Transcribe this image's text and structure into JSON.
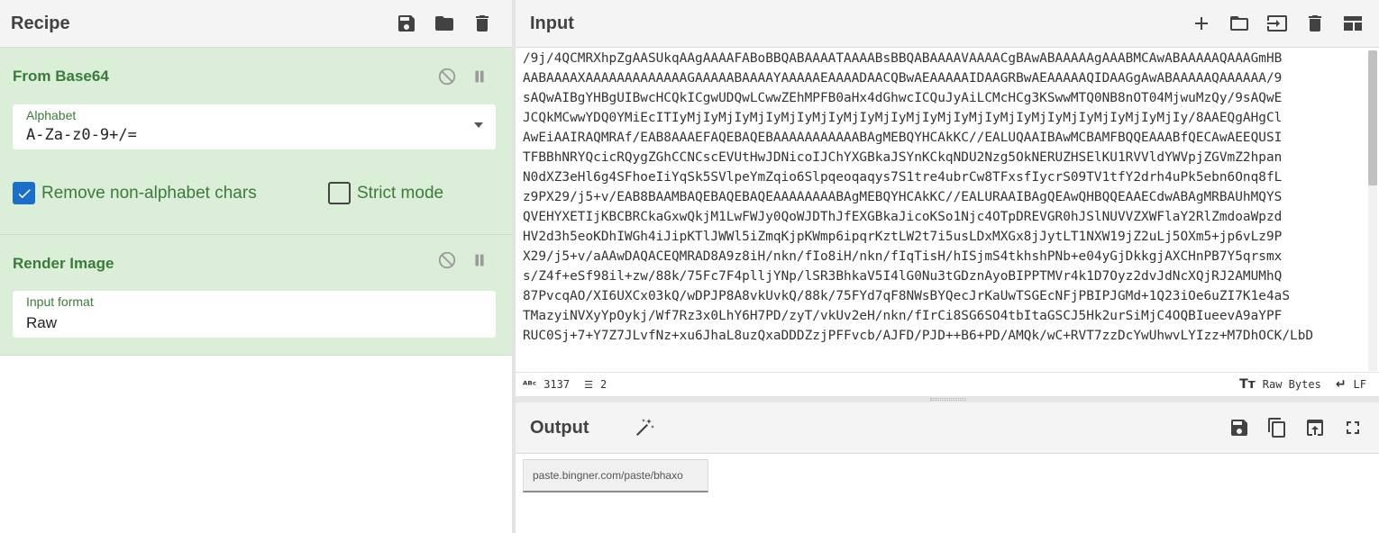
{
  "recipe": {
    "title": "Recipe",
    "operations": [
      {
        "name": "From Base64",
        "alphabet_label": "Alphabet",
        "alphabet_value": "A-Za-z0-9+/=",
        "remove_nonalpha_label": "Remove non-alphabet chars",
        "remove_nonalpha_checked": true,
        "strict_mode_label": "Strict mode",
        "strict_mode_checked": false
      },
      {
        "name": "Render Image",
        "input_format_label": "Input format",
        "input_format_value": "Raw"
      }
    ]
  },
  "input": {
    "title": "Input",
    "lines": [
      "/9j/4QCMRXhpZgAASUkqAAgAAAAFABoBBQABAAAATAAAABsBBQABAAAAVAAAACgBAwABAAAAAgAAABMCAwABAAAAAQAAAGmHB",
      "AABAAAAXAAAAAAAAAAAAAGAAAAABAAAAYAAAAAEAAAADAACQBwAEAAAAAIDAAGRBwAEAAAAAQIDAAGgAwABAAAAAQAAAAAA/9",
      "sAQwAIBgYHBgUIBwcHCQkICgwUDQwLCwwZEhMPFB0aHx4dGhwcICQuJyAiLCMcHCg3KSwwMTQ0NB8nOT04MjwuMzQy/9sAQwE",
      "JCQkMCwwYDQ0YMiEcITIyMjIyMjIyMjIyMjIyMjIyMjIyMjIyMjIyMjIyMjIyMjIyMjIyMjIyMjIyMjIyMjIy/8AAEQgAHgCl",
      "AwEiAAIRAQMRAf/EAB8AAAEFAQEBAQEBAAAAAAAAAAABAgMEBQYHCAkKC//EALUQAAIBAwMCBAMFBQQEAAABfQECAwAEEQUSI",
      "TFBBhNRYQcicRQygZGhCCNCscEVUtHwJDNicoIJChYXGBkaJSYnKCkqNDU2Nzg5OkNERUZHSElKU1RVVldYWVpjZGVmZ2hpan",
      "N0dXZ3eHl6g4SFhoeIiYqSk5SVlpeYmZqio6Slpqeoqaqys7S1tre4ubrCw8TFxsfIycrS09TV1tfY2drh4uPk5ebn6Onq8fL",
      "z9PX29/j5+v/EAB8BAAMBAQEBAQEBAQEAAAAAAAABAgMEBQYHCAkKC//EALURAAIBAgQEAwQHBQQEAAECdwABAgMRBAUhMQYS",
      "QVEHYXETIjKBCBRCkaGxwQkjM1LwFWJy0QoWJDThJfEXGBkaJicoKSo1Njc4OTpDREVGR0hJSlNUVVZXWFlaY2RlZmdoaWpzd",
      "HV2d3h5eoKDhIWGh4iJipKTlJWWl5iZmqKjpKWmp6ipqrKztLW2t7i5usLDxMXGx8jJytLT1NXW19jZ2uLj5OXm5+jp6vLz9P",
      "X29/j5+v/aAAwDAQACEQMRAD8A9z8iH/nkn/fIo8iH/nkn/fIqTisH/hISjmS4tkhshPNb+e04yGjDkkgjAXCHnPB7Y5qrsmx",
      "s/Z4f+eSf98il+zw/88k/75Fc7F4plljYNp/lSR3BhkaV5I4lG0Nu3tGDznAyoBIPPTMVr4k1D7Oyz2dvJdNcXQjRJ2AMUMhQ",
      "87PvcqAO/XI6UXCx03kQ/wDPJP8A8vkUvkQ/88k/75FYd7qF8NWsBYQecJrKaUwTSGEcNFjPBIPJGMd+1Q23iOe6uZI7K1e4aS",
      "TMazyiNVXyYpOykj/Wf7Rz3x0LhY6H7PD/zyT/vkUv2eH/nkn/fIrCi8SG6SO4tbItaGSCJ5Hk2urSiMjC4OQBIueevA9aYPF",
      "RUC0Sj+7+Y7Z7JLvfNz+xu6JhaL8uzQxaDDDZzjPFFvcb/AJFD/PJD++B6+PD/AMQk/wC+RVT7zzDcYwUhwvLYIzz+M7DhOCK/LbD"
    ]
  },
  "status": {
    "length": "3137",
    "lines": "2",
    "encoding": "Raw Bytes",
    "eol": "LF"
  },
  "output": {
    "title": "Output",
    "image_text": "paste.bingner.com/paste/bhaxo"
  }
}
